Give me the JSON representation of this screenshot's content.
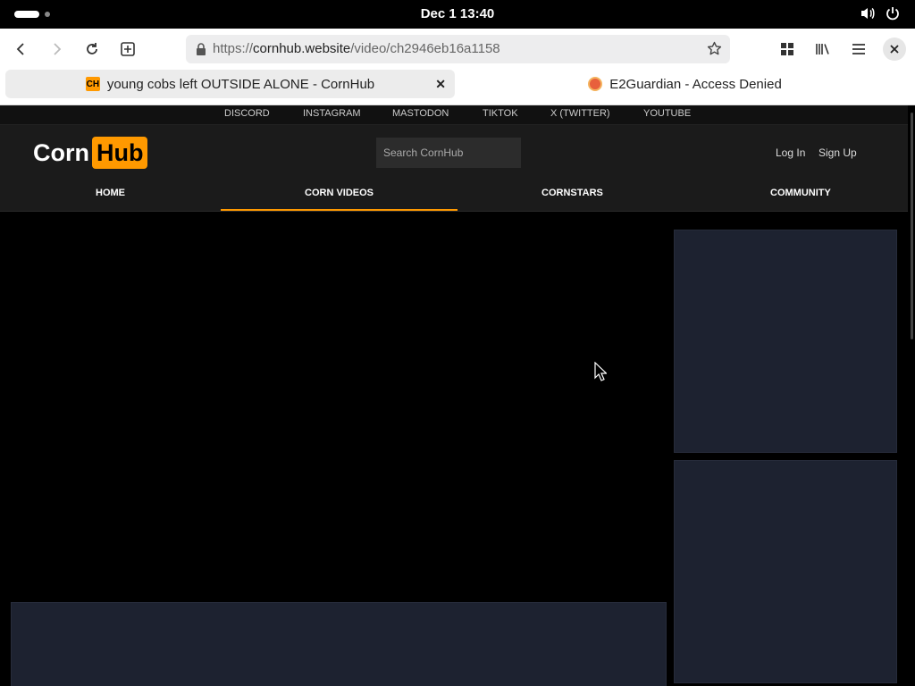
{
  "system_bar": {
    "clock": "Dec 1  13:40"
  },
  "browser": {
    "url_scheme": "https://",
    "url_host": "cornhub.website",
    "url_path": "/video/ch2946eb16a1158",
    "tabs": [
      {
        "favicon": "CH",
        "title": "young cobs left OUTSIDE ALONE - CornHub",
        "active": true
      },
      {
        "favicon": "e2guardian-icon",
        "title": "E2Guardian - Access Denied",
        "active": false
      }
    ]
  },
  "page": {
    "social_links": [
      "DISCORD",
      "INSTAGRAM",
      "MASTODON",
      "TIKTOK",
      "X (TWITTER)",
      "YOUTUBE"
    ],
    "logo": {
      "part1": "Corn",
      "part2": "Hub"
    },
    "search_placeholder": "Search CornHub",
    "auth": {
      "login": "Log In",
      "signup": "Sign Up"
    },
    "menu": [
      "HOME",
      "CORN VIDEOS",
      "CORNSTARS",
      "COMMUNITY"
    ],
    "active_menu_index": 1
  },
  "colors": {
    "accent": "#ff9900",
    "header_bg": "#1b1b1b",
    "placeholder_panel": "#1d2230"
  }
}
